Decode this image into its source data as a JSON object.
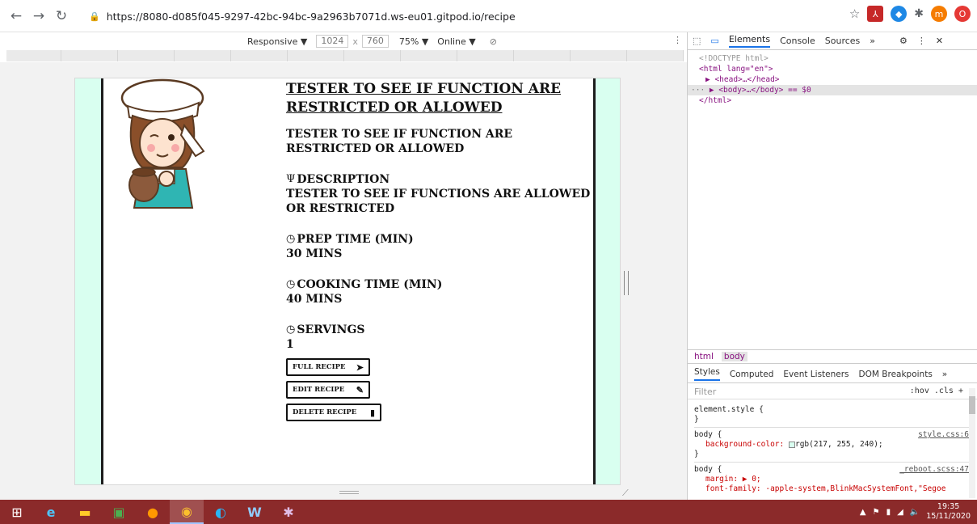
{
  "browser": {
    "url": "https://8080-d085f045-9297-42bc-94bc-9a2963b7071d.ws-eu01.gitpod.io/recipe",
    "profile_initial": "m"
  },
  "device_bar": {
    "mode": "Responsive ▼",
    "width": "1024",
    "separator": "x",
    "height": "760",
    "zoom": "75% ▼",
    "network": "Online ▼"
  },
  "recipe": {
    "title": "TESTER TO SEE IF FUNCTION ARE RESTRICTED OR ALLOWED",
    "subtitle": "TESTER TO SEE IF FUNCTION ARE RESTRICTED OR ALLOWED",
    "description_label": "DESCRIPTION",
    "description_value": "TESTER TO SEE IF FUNCTIONS ARE ALLOWED OR RESTRICTED",
    "prep_label": "PREP TIME (MIN)",
    "prep_value": "30 MINS",
    "cook_label": "COOKING TIME (MIN)",
    "cook_value": "40 MINS",
    "servings_label": "SERVINGS",
    "servings_value": "1",
    "buttons": {
      "full": "FULL RECIPE",
      "edit": "EDIT RECIPE",
      "delete": "DELETE RECIPE"
    }
  },
  "devtools": {
    "tabs": [
      "Elements",
      "Console",
      "Sources",
      "»"
    ],
    "dom": {
      "doctype": "<!DOCTYPE html>",
      "html_open": "<html lang=\"en\">",
      "head": "▶ <head>…</head>",
      "body": "▶ <body>…</body> == $0",
      "html_close": "</html>"
    },
    "breadcrumbs": [
      "html",
      "body"
    ],
    "style_tabs": [
      "Styles",
      "Computed",
      "Event Listeners",
      "DOM Breakpoints",
      "»"
    ],
    "filter_placeholder": "Filter",
    "filter_tools": ":hov  .cls  +",
    "rules": {
      "r1_selector": "element.style {",
      "r1_close": "}",
      "r2_selector": "body {",
      "r2_source": "style.css:6",
      "r2_prop": "background-color:",
      "r2_value": "rgb(217, 255, 240);",
      "r2_close": "}",
      "r3_selector": "body {",
      "r3_source": "_reboot.scss:47",
      "r3_prop1": "margin: ▶ 0;",
      "r3_prop2": "font-family: -apple-system,BlinkMacSystemFont,\"Segoe"
    }
  },
  "taskbar": {
    "time": "19:35",
    "date": "15/11/2020"
  },
  "colors": {
    "page_bg": "#d9fff0",
    "taskbar": "#8b2a2a",
    "accent": "#1a73e8"
  }
}
